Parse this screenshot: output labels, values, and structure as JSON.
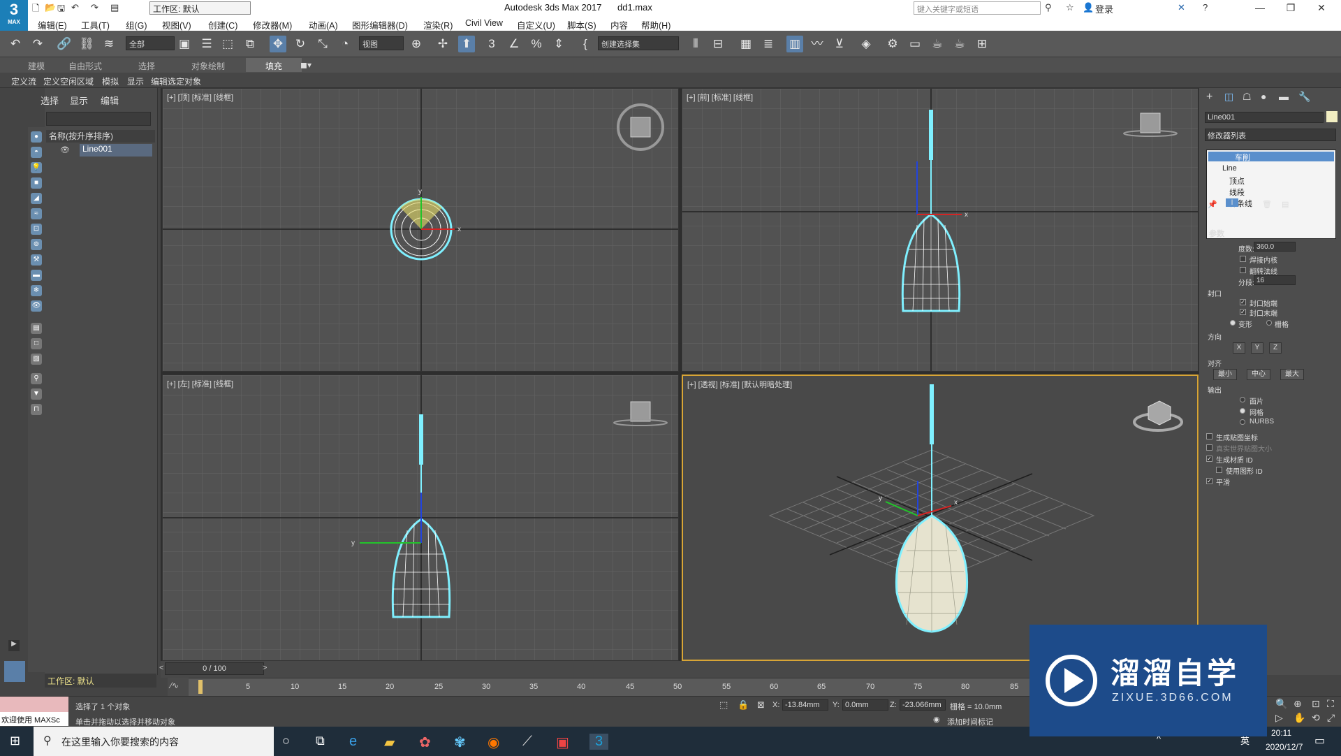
{
  "titlebar": {
    "workspace_label": "工作区: 默认",
    "app_title": "Autodesk 3ds Max 2017",
    "file_name": "dd1.max",
    "search_placeholder": "键入关键字或短语",
    "login_label": "登录",
    "logo_text": "3",
    "logo_sub": "MAX"
  },
  "menu": [
    "编辑(E)",
    "工具(T)",
    "组(G)",
    "视图(V)",
    "创建(C)",
    "修改器(M)",
    "动画(A)",
    "图形编辑器(D)",
    "渲染(R)",
    "Civil View",
    "自定义(U)",
    "脚本(S)",
    "内容",
    "帮助(H)"
  ],
  "toolbar": {
    "selection_filter": "全部",
    "ref_coord": "视图",
    "selection_set": "创建选择集"
  },
  "ribbon_tabs": [
    "建模",
    "自由形式",
    "选择",
    "对象绘制",
    "填充"
  ],
  "subribbon": [
    "定义流",
    "定义空闲区域",
    "模拟",
    "显示",
    "编辑选定对象"
  ],
  "scene_explorer": {
    "tabs": [
      "选择",
      "显示",
      "编辑"
    ],
    "column_header": "名称(按升序排序)",
    "objects": [
      "Line001"
    ],
    "workspace": "工作区: 默认"
  },
  "viewports": {
    "top": "[+] [顶] [标准] [线框]",
    "front": "[+] [前] [标准] [线框]",
    "left": "[+] [左] [标准] [线框]",
    "persp": "[+] [透视] [标准] [默认明暗处理]"
  },
  "command_panel": {
    "object_name": "Line001",
    "modifier_list": "修改器列表",
    "stack": [
      "车削",
      "Line",
      "顶点",
      "线段",
      "样条线"
    ],
    "rollout_title": "参数",
    "degrees_label": "度数:",
    "degrees_value": "360.0",
    "weld_core": "焊接内核",
    "flip_normals": "翻转法线",
    "segments_label": "分段:",
    "segments_value": "16",
    "capping_title": "封口",
    "cap_start": "封口始端",
    "cap_end": "封口末端",
    "morph": "变形",
    "grid": "栅格",
    "direction_title": "方向",
    "dir_x": "X",
    "dir_y": "Y",
    "dir_z": "Z",
    "align_title": "对齐",
    "align_min": "最小",
    "align_center": "中心",
    "align_max": "最大",
    "output_title": "输出",
    "out_patch": "面片",
    "out_mesh": "网格",
    "out_nurbs": "NURBS",
    "gen_map": "生成贴图坐标",
    "real_world": "真实世界贴图大小",
    "gen_mat": "生成材质 ID",
    "use_shape": "使用图形 ID",
    "smooth": "平滑"
  },
  "timeline": {
    "slider": "0 / 100",
    "ticks": [
      "5",
      "10",
      "15",
      "20",
      "25",
      "30",
      "35",
      "40",
      "45",
      "50",
      "55",
      "60",
      "65",
      "70",
      "75",
      "80",
      "85"
    ]
  },
  "status": {
    "selected": "选择了 1 个对象",
    "hint": "单击并拖动以选择并移动对象",
    "welcome": "欢迎使用 MAXSc",
    "x_label": "X:",
    "x_value": "-13.84mm",
    "y_label": "Y:",
    "y_value": "0.0mm",
    "z_label": "Z:",
    "z_value": "-23.066mm",
    "grid": "栅格 = 10.0mm",
    "add_time_tag": "添加时间标记"
  },
  "taskbar": {
    "search_placeholder": "在这里输入你要搜索的内容",
    "time": "20:11",
    "date": "2020/12/7",
    "ime": "英"
  },
  "watermark": {
    "main": "溜溜自学",
    "sub": "ZIXUE.3D66.COM"
  },
  "colors": {
    "accent_cyan": "#7ff0ff",
    "active_viewport_border": "#d8a536",
    "selection_blue": "#1c7fb8"
  }
}
